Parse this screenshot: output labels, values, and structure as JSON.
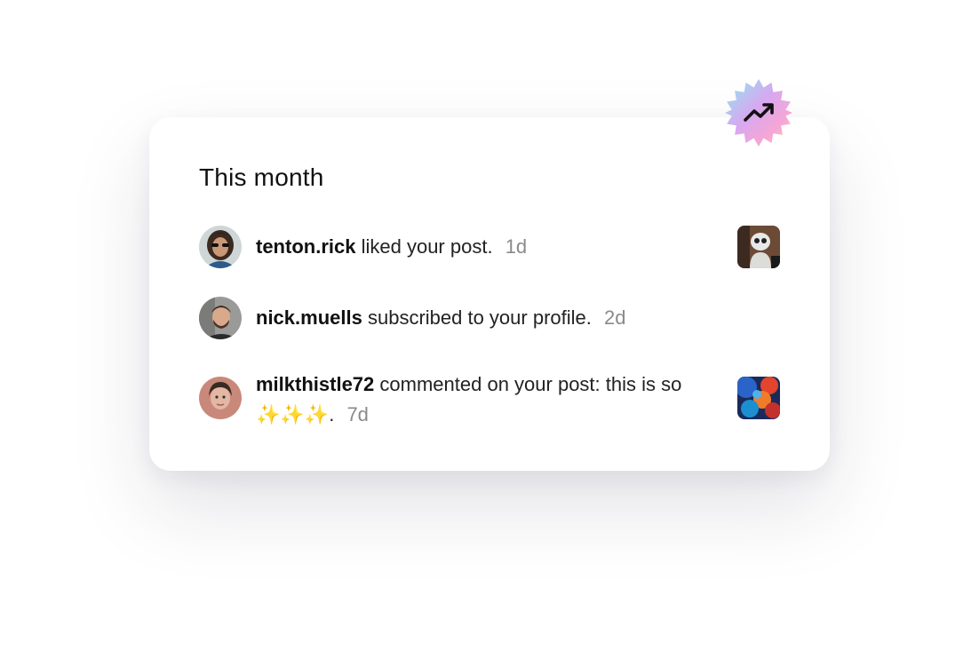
{
  "card": {
    "title": "This month"
  },
  "badge": {
    "icon": "trending-up-icon"
  },
  "notifications": [
    {
      "username": "tenton.rick",
      "action": "liked your post.",
      "time": "1d",
      "avatar": "avatar-man-sunglasses",
      "thumbnail": "robot-photo"
    },
    {
      "username": "nick.muells",
      "action": "subscribed to your profile.",
      "time": "2d",
      "avatar": "avatar-man-beard"
    },
    {
      "username": "milkthistle72",
      "action": "commented on your post: this is so",
      "sparkles": "✨✨✨",
      "period": ".",
      "time": "7d",
      "avatar": "avatar-woman",
      "thumbnail": "colorful-abstract-photo"
    }
  ]
}
